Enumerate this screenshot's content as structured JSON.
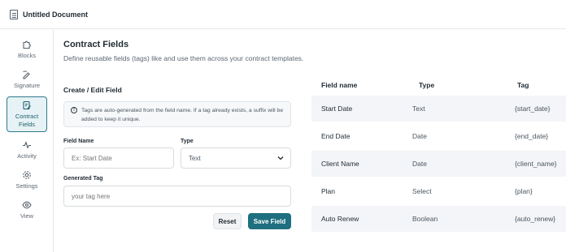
{
  "document": {
    "title": "Untitled Document"
  },
  "sidebar": {
    "items": [
      {
        "label": "Blocks",
        "icon": "puzzle-icon"
      },
      {
        "label": "Signature",
        "icon": "signature-icon"
      },
      {
        "label": "Contract Fields",
        "icon": "edit-document-icon",
        "active": true
      },
      {
        "label": "Activity",
        "icon": "activity-icon"
      },
      {
        "label": "Settings",
        "icon": "gear-icon"
      },
      {
        "label": "View",
        "icon": "eye-icon"
      }
    ]
  },
  "page": {
    "title": "Contract Fields",
    "subtitle": "Define reusable fields (tags) like and use them across your contract templates."
  },
  "form": {
    "title": "Create / Edit Field",
    "notice": "Tags are auto-generated from the field name. If a tag already exists, a suffix will be added to keep it unique.",
    "field_name_label": "Field Name",
    "field_name_placeholder": "Ex: Start Date",
    "type_label": "Type",
    "type_value": "Text",
    "generated_tag_label": "Generated Tag",
    "generated_tag_placeholder": "your tag here",
    "reset_label": "Reset",
    "save_label": "Save Field"
  },
  "table": {
    "columns": [
      "Field name",
      "Type",
      "Tag"
    ],
    "rows": [
      {
        "name": "Start Date",
        "type": "Text",
        "tag": "{start_date}"
      },
      {
        "name": "End Date",
        "type": "Date",
        "tag": "{end_date}"
      },
      {
        "name": "Client Name",
        "type": "Date",
        "tag": "{client_name}"
      },
      {
        "name": "Plan",
        "type": "Select",
        "tag": "{plan}"
      },
      {
        "name": "Auto Renew",
        "type": "Boolean",
        "tag": "{auto_renew}"
      }
    ]
  },
  "colors": {
    "accent": "#1e6f7f",
    "active_bg": "#e6f2f5",
    "row_shade": "#f3f5f8"
  }
}
